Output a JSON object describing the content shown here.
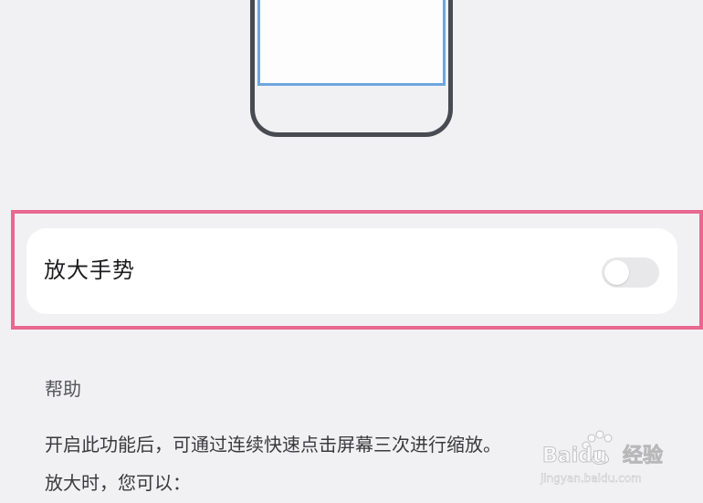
{
  "setting": {
    "label": "放大手势",
    "enabled": false
  },
  "help": {
    "heading": "帮助",
    "lines": [
      "开启此功能后，可通过连续快速点击屏幕三次进行缩放。",
      "放大时，您可以："
    ]
  },
  "watermark": {
    "brand": "Baidu",
    "product": "经验",
    "url": "jingyan.baidu.com"
  },
  "colors": {
    "background": "#f1f1f4",
    "highlight": "#e8688f",
    "phone_screen": "#6fa6df",
    "toggle_off": "#e8e8ea"
  }
}
